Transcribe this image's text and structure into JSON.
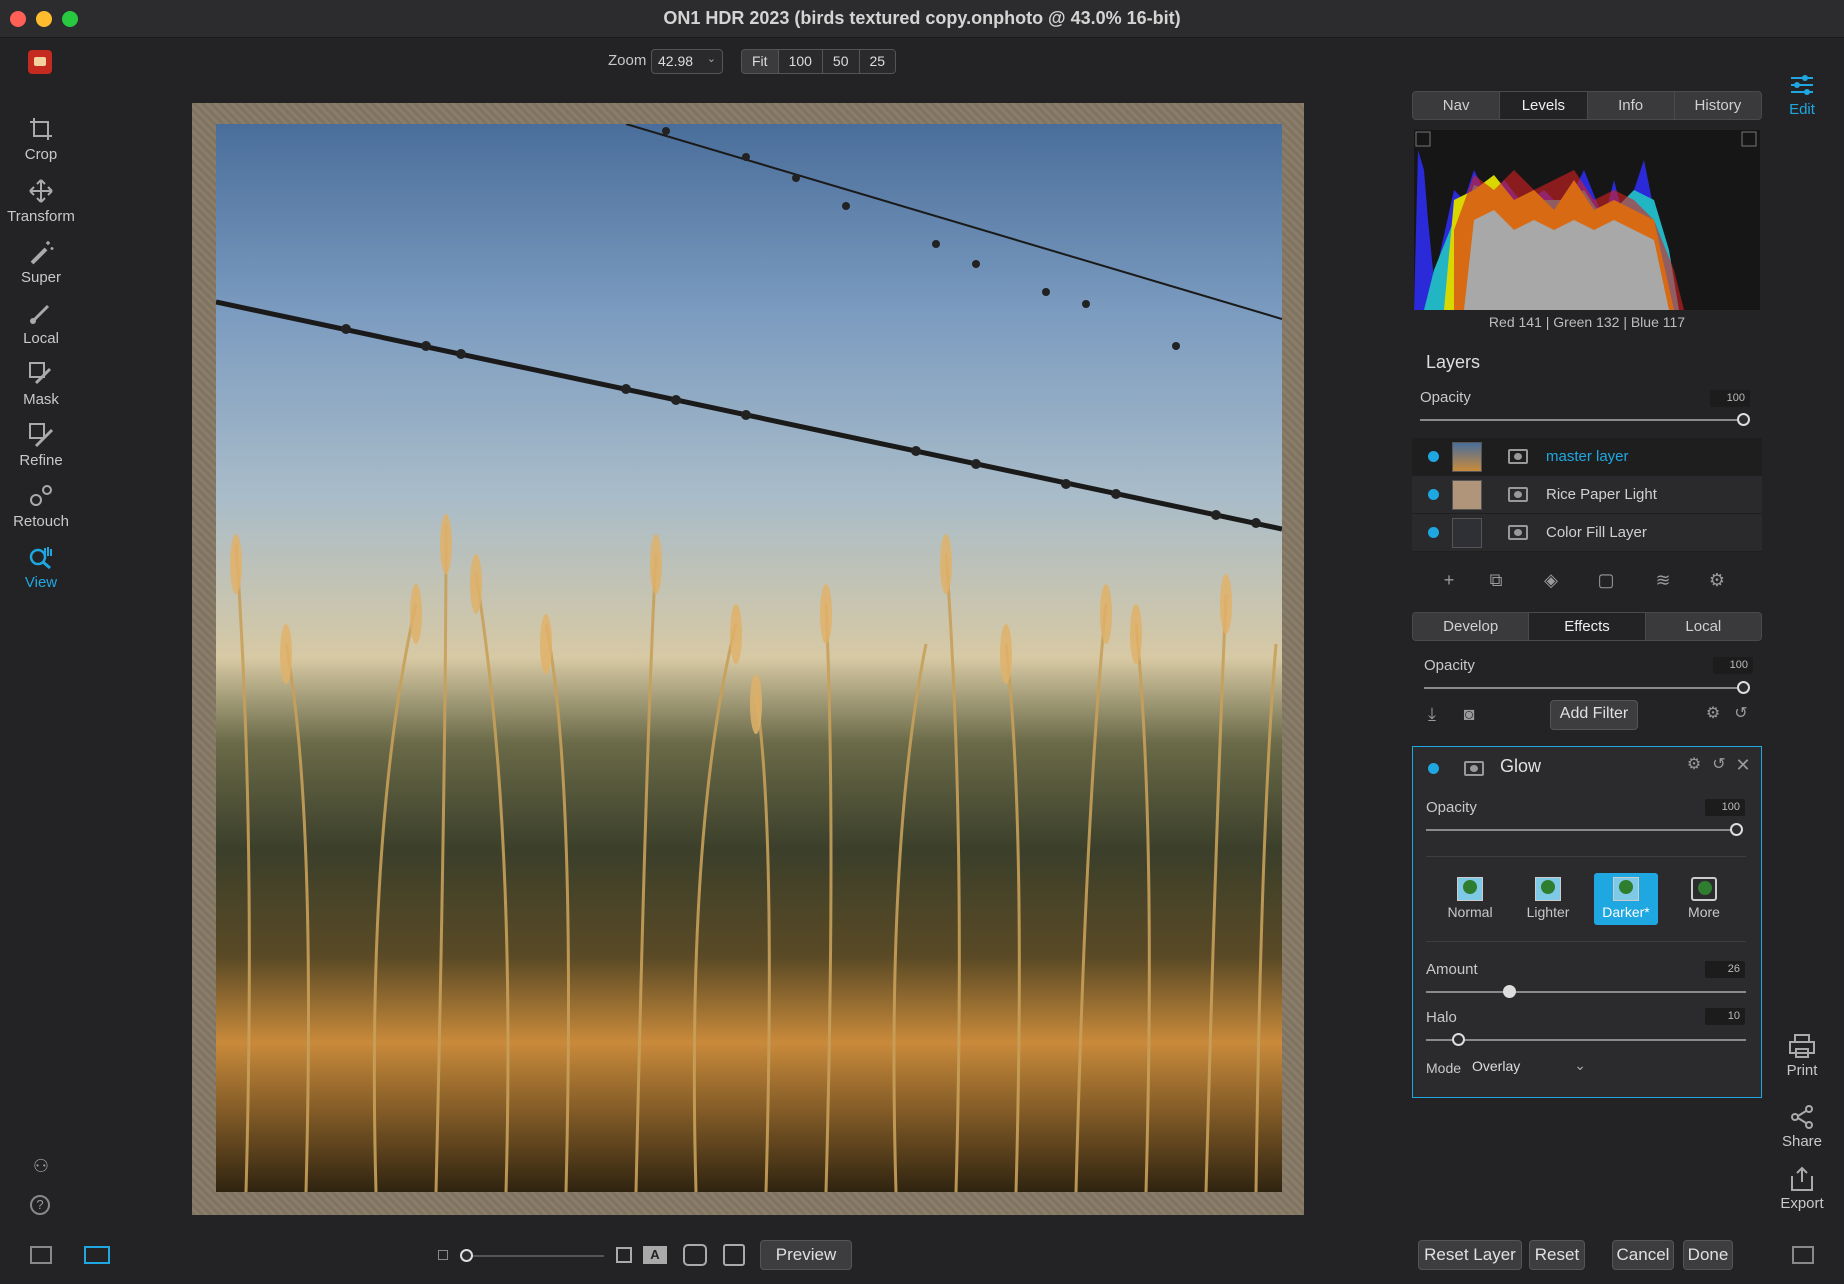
{
  "window": {
    "title": "ON1 HDR 2023 (birds textured copy.onphoto @ 43.0% 16-bit)"
  },
  "zoom": {
    "label": "Zoom",
    "value": "42.98",
    "presets": [
      "Fit",
      "100",
      "50",
      "25"
    ]
  },
  "tools": [
    {
      "label": "Crop",
      "icon": "crop-icon"
    },
    {
      "label": "Transform",
      "icon": "move-icon"
    },
    {
      "label": "Super",
      "icon": "magic-wand-icon"
    },
    {
      "label": "Local",
      "icon": "brush-icon"
    },
    {
      "label": "Mask",
      "icon": "mask-brush-icon"
    },
    {
      "label": "Refine",
      "icon": "refine-brush-icon"
    },
    {
      "label": "Retouch",
      "icon": "retouch-icon"
    },
    {
      "label": "View",
      "icon": "view-hand-icon",
      "active": true
    }
  ],
  "info_tabs": {
    "items": [
      "Nav",
      "Levels",
      "Info",
      "History"
    ],
    "active": "Levels"
  },
  "histogram": {
    "readout": "Red 141 | Green 132 | Blue 117"
  },
  "layers": {
    "title": "Layers",
    "opacity_label": "Opacity",
    "opacity_value": "100",
    "items": [
      {
        "name": "master layer",
        "selected": true
      },
      {
        "name": "Rice Paper Light",
        "selected": false
      },
      {
        "name": "Color Fill Layer",
        "selected": false
      }
    ]
  },
  "module_tabs": {
    "items": [
      "Develop",
      "Effects",
      "Local"
    ],
    "active": "Effects"
  },
  "effects": {
    "opacity_label": "Opacity",
    "opacity_value": "100",
    "add_filter": "Add Filter"
  },
  "glow": {
    "name": "Glow",
    "opacity_label": "Opacity",
    "opacity_value": "100",
    "blend_options": [
      "Normal",
      "Lighter",
      "Darker*",
      "More"
    ],
    "active_blend": "Darker*",
    "amount_label": "Amount",
    "amount_value": "26",
    "amount_fraction": 0.26,
    "halo_label": "Halo",
    "halo_value": "10",
    "halo_fraction": 0.1,
    "mode_label": "Mode",
    "mode_value": "Overlay"
  },
  "right_rail": {
    "edit": "Edit",
    "print": "Print",
    "share": "Share",
    "export": "Export"
  },
  "bottom": {
    "preview": "Preview",
    "reset_layer": "Reset Layer",
    "reset": "Reset",
    "cancel": "Cancel",
    "done": "Done"
  },
  "colors": {
    "accent": "#1ea7e1",
    "background": "#232325"
  }
}
